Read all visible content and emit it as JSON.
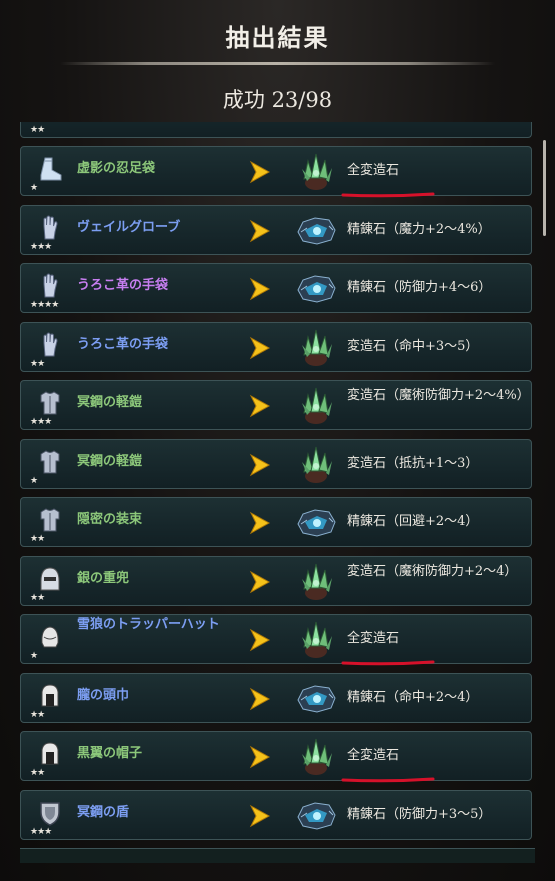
{
  "header": {
    "title": "抽出結果",
    "success_text": "成功 23/98"
  },
  "colors": {
    "green_name": "#8cc77a",
    "blue_name": "#7c9ef2",
    "purple_name": "#c77ef0",
    "arrow": "#f5c21a",
    "underline": "#d6112a"
  },
  "top_partial_stars": "★★",
  "rows": [
    {
      "name": "虚影の忍足袋",
      "stars": "★",
      "name_color": "green",
      "equip_icon": "boot-icon",
      "gem": "green-crystal-icon",
      "result": "全変造石",
      "underlined": true
    },
    {
      "name": "ヴェイルグローブ",
      "stars": "★★★",
      "name_color": "blue",
      "equip_icon": "glove-icon",
      "gem": "blue-ore-icon",
      "result": "精錬石（魔力+2～4%）",
      "underlined": false
    },
    {
      "name": "うろこ革の手袋",
      "stars": "★★★★",
      "name_color": "purple",
      "equip_icon": "glove-icon",
      "gem": "blue-ore-icon",
      "result": "精錬石（防御力+4～6）",
      "underlined": false
    },
    {
      "name": "うろこ革の手袋",
      "stars": "★★",
      "name_color": "blue",
      "equip_icon": "glove-icon",
      "gem": "green-crystal-icon",
      "result": "変造石（命中+3～5）",
      "underlined": false
    },
    {
      "name": "冥鋼の軽鎧",
      "stars": "★★★",
      "name_color": "green",
      "equip_icon": "armor-icon",
      "gem": "green-crystal-icon",
      "result": "変造石（魔術防御力+2～4%）",
      "underlined": false
    },
    {
      "name": "冥鋼の軽鎧",
      "stars": "★",
      "name_color": "green",
      "equip_icon": "armor-icon",
      "gem": "green-crystal-icon",
      "result": "変造石（抵抗+1～3）",
      "underlined": false
    },
    {
      "name": "隠密の装束",
      "stars": "★★",
      "name_color": "green",
      "equip_icon": "armor-icon",
      "gem": "blue-ore-icon",
      "result": "精錬石（回避+2～4）",
      "underlined": false
    },
    {
      "name": "銀の重兜",
      "stars": "★★",
      "name_color": "green",
      "equip_icon": "helmet-icon",
      "gem": "green-crystal-icon",
      "result": "変造石（魔術防御力+2～4）",
      "underlined": false
    },
    {
      "name": "雪狼のトラッパーハット",
      "stars": "★",
      "name_color": "blue",
      "equip_icon": "hat-icon",
      "gem": "green-crystal-icon",
      "result": "全変造石",
      "underlined": true
    },
    {
      "name": "朧の頭巾",
      "stars": "★★",
      "name_color": "blue",
      "equip_icon": "hood-icon",
      "gem": "blue-ore-icon",
      "result": "精錬石（命中+2～4）",
      "underlined": false
    },
    {
      "name": "黒翼の帽子",
      "stars": "★★",
      "name_color": "green",
      "equip_icon": "hood-icon",
      "gem": "green-crystal-icon",
      "result": "全変造石",
      "underlined": true
    },
    {
      "name": "冥鋼の盾",
      "stars": "★★★",
      "name_color": "blue",
      "equip_icon": "shield-icon",
      "gem": "blue-ore-icon",
      "result": "精錬石（防御力+3～5）",
      "underlined": false
    }
  ]
}
